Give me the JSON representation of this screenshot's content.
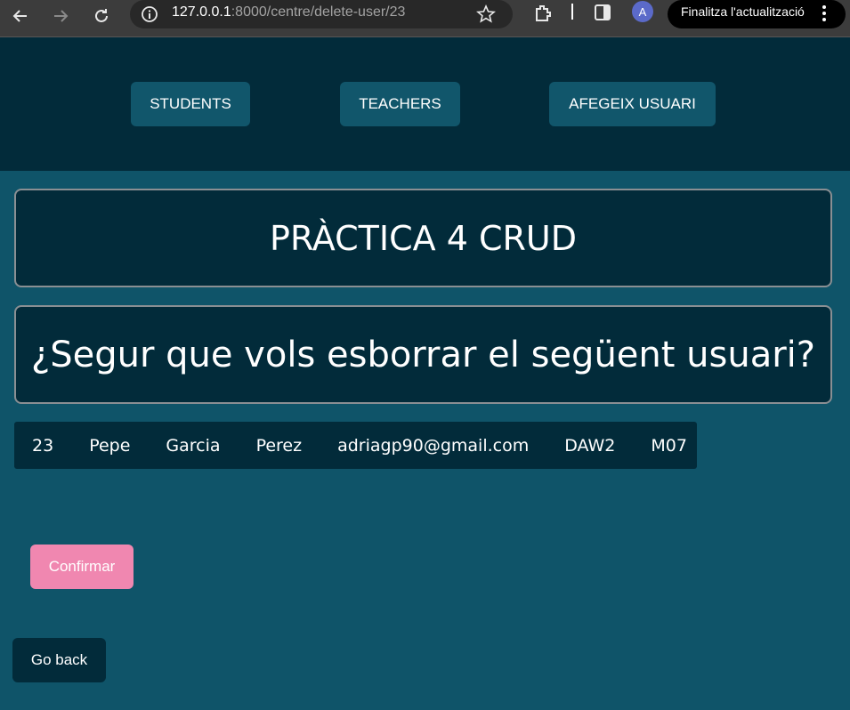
{
  "browser": {
    "url_host": "127.0.0.1",
    "url_rest": ":8000/centre/delete-user/23",
    "avatar_letter": "A",
    "update_label": "Finalitza l'actualització",
    "icons": [
      "back-arrow-icon",
      "forward-arrow-icon",
      "reload-icon",
      "info-icon",
      "star-icon",
      "extensions-icon",
      "side-panel-icon",
      "kebab-menu-icon"
    ]
  },
  "nav": {
    "students": "STUDENTS",
    "teachers": "TEACHERS",
    "afegeix": "AFEGEIX USUARI"
  },
  "page": {
    "title": "PRÀCTICA 4 CRUD",
    "question": "¿Segur que vols esborrar el següent usuari?"
  },
  "user": {
    "id": "23",
    "first_name": "Pepe",
    "last_name": "Garcia",
    "second_last_name": "Perez",
    "email": "adriagp90@gmail.com",
    "course": "DAW2",
    "module": "M07"
  },
  "actions": {
    "confirm": "Confirmar",
    "back": "Go back"
  },
  "colors": {
    "page_bg": "#0f5469",
    "header_bg": "#022b3a",
    "nav_button_bg": "#11566b",
    "confirm_bg": "#f087b0"
  }
}
